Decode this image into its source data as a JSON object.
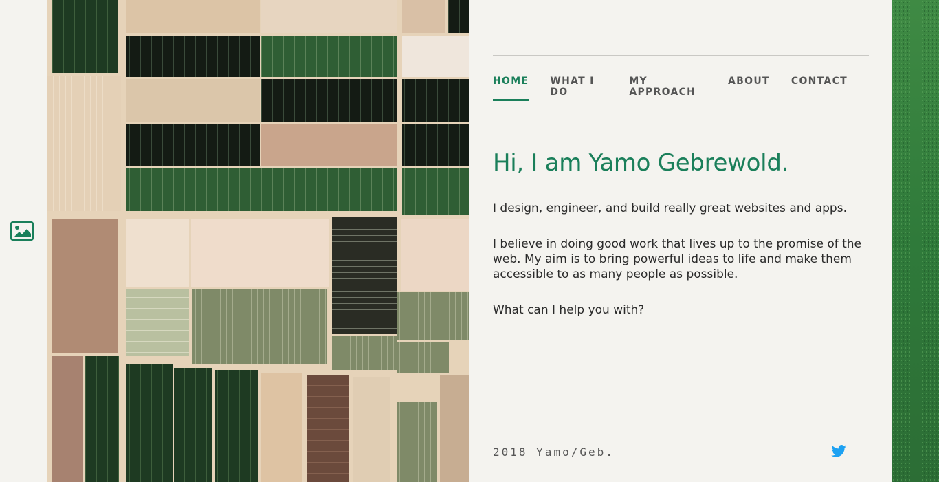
{
  "gallery": {
    "icon": "image-icon",
    "color": "#1a7f5a"
  },
  "nav": {
    "items": [
      {
        "label": "HOME",
        "active": true
      },
      {
        "label": "WHAT I DO",
        "active": false
      },
      {
        "label": "MY APPROACH",
        "active": false
      },
      {
        "label": "ABOUT",
        "active": false
      },
      {
        "label": "CONTACT",
        "active": false
      }
    ]
  },
  "hero": {
    "title": "Hi, I am Yamo Gebrewold."
  },
  "intro": {
    "line1": "I design, engineer, and build really great websites and apps.",
    "line2": "I believe in doing good work that lives up to the promise of the web. My aim is to bring powerful ideas to life and make them accessible to as many people as possible.",
    "line3": "What can I help you with?"
  },
  "footer": {
    "copyright": "2018 Yamo/Geb.",
    "social_icon": "twitter-icon"
  },
  "colors": {
    "accent": "#1a7f5a",
    "background": "#f4f3ef",
    "twitter": "#1da1f2"
  }
}
